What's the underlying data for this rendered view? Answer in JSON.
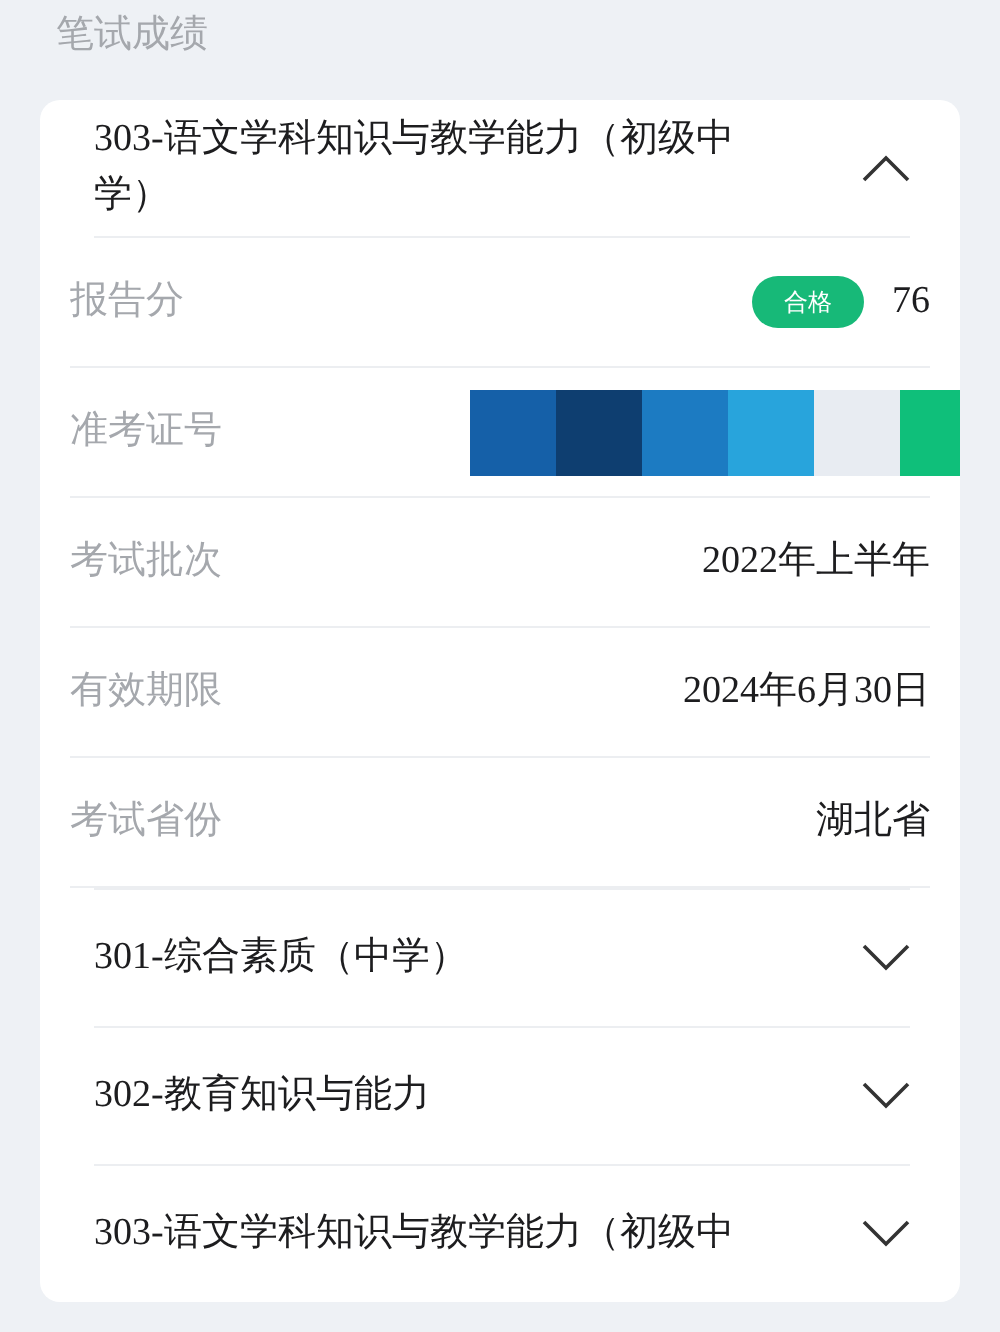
{
  "section_title": "笔试成绩",
  "exams": [
    {
      "title": "303-语文学科知识与教学能力（初级中学）",
      "expanded": true,
      "details": [
        {
          "kind": "score",
          "label": "报告分",
          "badge": "合格",
          "value": "76"
        },
        {
          "kind": "masked",
          "label": "准考证号",
          "mask": [
            {
              "color": "#1560a8"
            },
            {
              "color": "#0e3e70"
            },
            {
              "color": "#1c7bc2"
            },
            {
              "color": "#28a4dc"
            },
            {
              "color": "#e8ecf2"
            },
            {
              "color": "#0fbf7a"
            }
          ]
        },
        {
          "kind": "text",
          "label": "考试批次",
          "value": "2022年上半年"
        },
        {
          "kind": "text",
          "label": "有效期限",
          "value": "2024年6月30日"
        },
        {
          "kind": "text",
          "label": "考试省份",
          "value": "湖北省"
        }
      ]
    },
    {
      "title": "301-综合素质（中学）",
      "expanded": false
    },
    {
      "title": "302-教育知识与能力",
      "expanded": false
    },
    {
      "title": "303-语文学科知识与教学能力（初级中",
      "expanded": false
    }
  ]
}
